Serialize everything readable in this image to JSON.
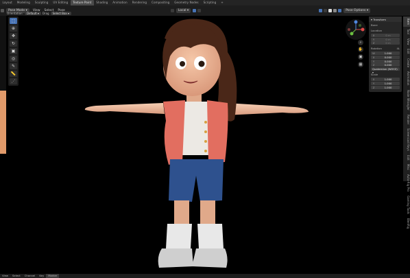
{
  "topbar": {
    "tabs": [
      "Layout",
      "Modeling",
      "Sculpting",
      "UV Editing",
      "Texture Paint",
      "Shading",
      "Animation",
      "Rendering",
      "Compositing",
      "Geometry Nodes",
      "Scripting"
    ],
    "active_tab": "Texture Paint",
    "add_tab": "+"
  },
  "header": {
    "mode": "Pose Mode",
    "menus": [
      "View",
      "Select",
      "Pose"
    ],
    "orientation_label": "Orientation:",
    "orientation_value": "Default",
    "drag_label": "Drag",
    "drag_value": "Select Box",
    "transform_space": "Local",
    "options_label": "Pose Options"
  },
  "tools": [
    "select-box",
    "cursor",
    "move",
    "rotate",
    "scale",
    "transform",
    "annotate",
    "measure",
    "pose"
  ],
  "npanel": {
    "title": "Transform",
    "bone_label": "Bone",
    "location_label": "Location",
    "location": [
      {
        "ax": "X",
        "v": "0 m"
      },
      {
        "ax": "Y",
        "v": "0 m"
      },
      {
        "ax": "Z",
        "v": "0 m"
      }
    ],
    "rotation_label": "Rotation",
    "rotation_mode_tag": "4L",
    "rotation": [
      {
        "ax": "W",
        "v": "1.000"
      },
      {
        "ax": "X",
        "v": "0.000"
      },
      {
        "ax": "Y",
        "v": "0.000"
      },
      {
        "ax": "Z",
        "v": "0.000"
      }
    ],
    "rotation_mode": "Quaternion (WXYZ)",
    "scale_label": "Scale",
    "scale": [
      {
        "ax": "X",
        "v": "1.000"
      },
      {
        "ax": "Y",
        "v": "1.000"
      },
      {
        "ax": "Z",
        "v": "1.000"
      }
    ]
  },
  "vtabs": [
    "Item",
    "Tool",
    "View",
    "Edit",
    "Create",
    "Animation",
    "Node Wrangler",
    "Render",
    "Screencast Keys",
    "Edit",
    "Misc",
    "Auto-Rig Pro",
    "Gaming Tools",
    "BlenRig"
  ],
  "bottombar": {
    "items": [
      "View",
      "Select",
      "Channel",
      "Key",
      "Marker"
    ],
    "highlight": "Marker"
  },
  "colors": {
    "accent": "#4772b3",
    "orange_strip": "#e19a6a",
    "shirt": "#e26e60",
    "shorts": "#2e518e",
    "hair": "#4a2718"
  }
}
